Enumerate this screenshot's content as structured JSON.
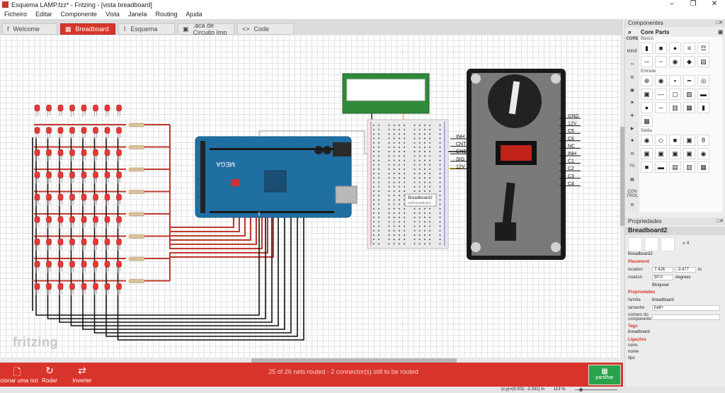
{
  "window": {
    "title": "Esquema LAMP.fzz* - Fritzing - [vista breadboard]",
    "minimize": "–",
    "maximize": "❐",
    "close": "✕"
  },
  "menu": [
    "Ficheiro",
    "Editar",
    "Componente",
    "Vista",
    "Janela",
    "Routing",
    "Ajuda"
  ],
  "tabs": [
    {
      "label": "Welcome",
      "icon": "f",
      "active": false
    },
    {
      "label": "Breadboard",
      "icon": "▦",
      "active": true
    },
    {
      "label": "Esquema",
      "icon": "⌇",
      "active": false
    },
    {
      "label": ".aca de Circuito Imp",
      "icon": "▣",
      "active": false
    },
    {
      "label": "Code",
      "icon": "<>",
      "active": false
    }
  ],
  "canvas": {
    "watermark": "fritzing",
    "arduino_label": "MEGA",
    "lcd_label": "",
    "breadboard_tooltip": {
      "title": "Breadboard2",
      "subtitle": "Half breadboard"
    },
    "coin_labels": [
      "GND",
      "12V",
      "C5",
      "C6",
      "NC",
      "INH",
      "C1",
      "C2",
      "C3",
      "C4"
    ],
    "relay_labels": [
      "INH",
      "CNT",
      "GND",
      "SIG",
      "12V"
    ]
  },
  "bottombar": {
    "add_note": "dicionar uma not",
    "rotate": "Rodar",
    "flip": "Inverter",
    "route_status": "25 of 26 nets routed - 2 connector(s) still to be routed",
    "share": "partilhar"
  },
  "statusbar": {
    "coords": "(x,y)=(9.002, -2.331) in",
    "zoom": "113 %"
  },
  "components_panel": {
    "title": "Componentes",
    "search_title": "Core Parts",
    "bins": [
      "CORE",
      "MINE",
      "∞",
      "⚙",
      "▣",
      "⚑",
      "❖",
      "▶",
      "■",
      "✉",
      "FA",
      "▦",
      "CON TROL",
      "⚙"
    ],
    "sections": [
      {
        "label": "Básico",
        "rows": [
          [
            "▮",
            "■",
            "●",
            "≡",
            "☲"
          ],
          [
            "─",
            "−",
            "◉",
            "◆",
            "▤"
          ]
        ]
      },
      {
        "label": "Entrada",
        "rows": [
          [
            "⊕",
            "◉",
            "▪",
            "━",
            "◎"
          ],
          [
            "▣",
            "―",
            "▢",
            "▧",
            "▬"
          ],
          [
            "●",
            "─",
            "▥",
            "▦",
            "▮"
          ],
          [
            "▩",
            "",
            "",
            "",
            ""
          ]
        ]
      },
      {
        "label": "Saída",
        "rows": [
          [
            "◉",
            "◇",
            "■",
            "▣",
            "8"
          ],
          [
            "▣",
            "▣",
            "▣",
            "▣",
            "◉"
          ],
          [
            "■",
            "▬",
            "▤",
            "▥",
            "▦"
          ]
        ]
      }
    ]
  },
  "properties_panel": {
    "title": "Propriedades",
    "part_name": "Breadboard2",
    "version": "v. 4",
    "instance": "Breadboard2",
    "placement_label": "Placement",
    "location_label": "location",
    "location_x": "7.426",
    "location_y": "-3.477",
    "location_unit": "in",
    "rotation_label": "rotation",
    "rotation_value": "90.0",
    "rotation_unit": "degrees",
    "lock_label": "Bloquear",
    "props_label": "Propriedades",
    "family_label": "família",
    "family_value": "breadboard",
    "size_label": "tamanho",
    "size_value": "half+",
    "part_number_label": "número do componente",
    "tags_label": "Tags",
    "tags_value": "breadboard",
    "connections_label": "Ligações",
    "conn_label": "conn.",
    "name_label": "nome",
    "type_label": "tipo"
  },
  "colors": {
    "accent": "#d9342b",
    "share": "#2aa24b",
    "arduino": "#1f6fa3",
    "wire_red": "#c0392b",
    "wire_black": "#111111"
  }
}
